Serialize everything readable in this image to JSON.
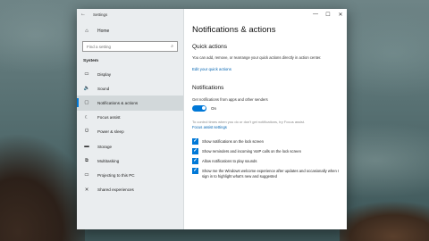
{
  "window": {
    "title": "Settings",
    "back_glyph": "←",
    "controls": {
      "minimize": "—",
      "maximize": "☐",
      "close": "✕"
    }
  },
  "sidebar": {
    "home_label": "Home",
    "search_placeholder": "Find a setting",
    "section_label": "System",
    "items": [
      {
        "label": "Display",
        "icon": "display-icon",
        "glyph": "▭"
      },
      {
        "label": "Sound",
        "icon": "speaker-icon",
        "glyph": "🔈"
      },
      {
        "label": "Notifications & actions",
        "icon": "notifications-icon",
        "glyph": "▢"
      },
      {
        "label": "Focus assist",
        "icon": "moon-icon",
        "glyph": "☾"
      },
      {
        "label": "Power & sleep",
        "icon": "power-icon",
        "glyph": "⏻"
      },
      {
        "label": "Storage",
        "icon": "storage-icon",
        "glyph": "▬"
      },
      {
        "label": "Multitasking",
        "icon": "multitasking-icon",
        "glyph": "⧉"
      },
      {
        "label": "Projecting to this PC",
        "icon": "projecting-icon",
        "glyph": "▭"
      },
      {
        "label": "Shared experiences",
        "icon": "shared-icon",
        "glyph": "✕"
      }
    ],
    "active_index": 2
  },
  "main": {
    "title": "Notifications & actions",
    "quick_actions": {
      "heading": "Quick actions",
      "description": "You can add, remove, or rearrange your quick actions directly in action center.",
      "edit_link": "Edit your quick actions"
    },
    "notifications": {
      "heading": "Notifications",
      "get_notifications_label": "Get notifications from apps and other senders",
      "toggle_state": "On",
      "focus_note": "To control times when you do or don't get notifications, try Focus assist.",
      "focus_link": "Focus assist settings",
      "checkboxes": [
        {
          "label": "Show notifications on the lock screen",
          "checked": true
        },
        {
          "label": "Show reminders and incoming VoIP calls on the lock screen",
          "checked": true
        },
        {
          "label": "Allow notifications to play sounds",
          "checked": true
        },
        {
          "label": "Show me the Windows welcome experience after updates and occasionally when I sign in to highlight what's new and suggested",
          "checked": true
        }
      ]
    }
  },
  "colors": {
    "accent": "#0078d7",
    "link": "#0063b1"
  }
}
